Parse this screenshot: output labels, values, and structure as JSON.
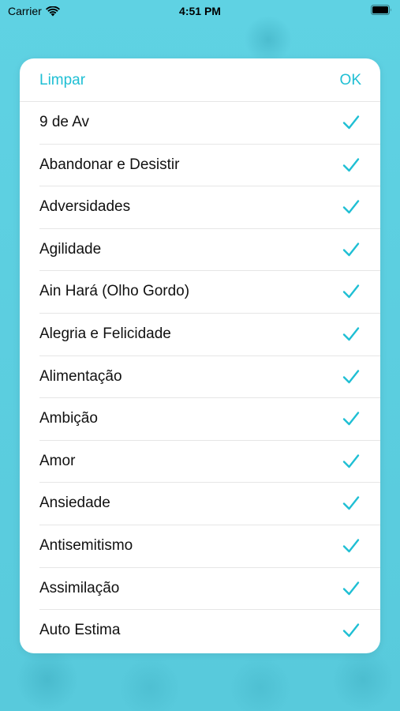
{
  "status_bar": {
    "carrier": "Carrier",
    "time": "4:51 PM"
  },
  "picker": {
    "clear_label": "Limpar",
    "ok_label": "OK",
    "accent_color": "#1fbfd4",
    "options": [
      {
        "label": "9 de Av",
        "checked": true
      },
      {
        "label": "Abandonar e Desistir",
        "checked": true
      },
      {
        "label": "Adversidades",
        "checked": true
      },
      {
        "label": "Agilidade",
        "checked": true
      },
      {
        "label": "Ain Hará (Olho Gordo)",
        "checked": true
      },
      {
        "label": "Alegria e Felicidade",
        "checked": true
      },
      {
        "label": "Alimentação",
        "checked": true
      },
      {
        "label": "Ambição",
        "checked": true
      },
      {
        "label": "Amor",
        "checked": true
      },
      {
        "label": "Ansiedade",
        "checked": true
      },
      {
        "label": "Antisemitismo",
        "checked": true
      },
      {
        "label": "Assimilação",
        "checked": true
      },
      {
        "label": "Auto Estima",
        "checked": true
      }
    ]
  }
}
